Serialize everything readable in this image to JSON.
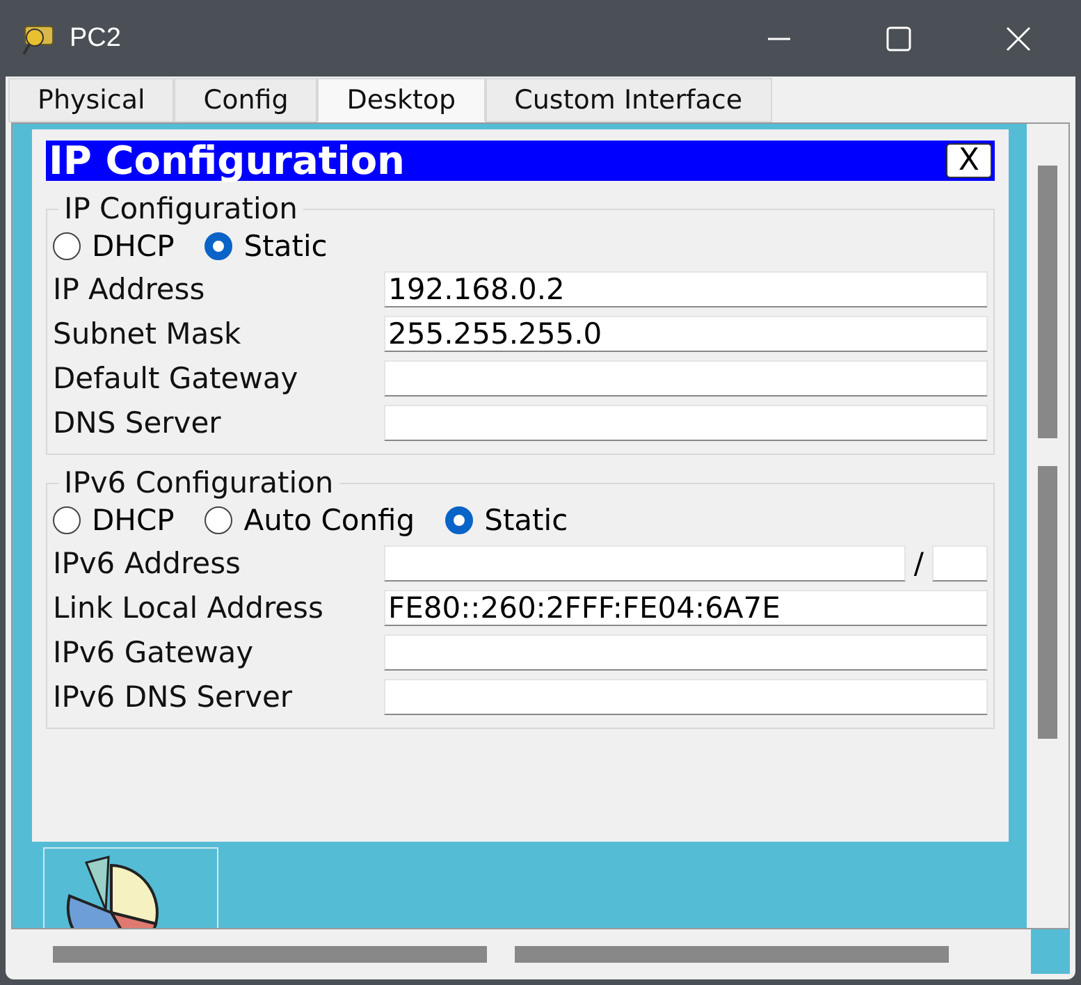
{
  "window": {
    "title": "PC2"
  },
  "tabs": [
    {
      "label": "Physical",
      "selected": false
    },
    {
      "label": "Config",
      "selected": false
    },
    {
      "label": "Desktop",
      "selected": true
    },
    {
      "label": "Custom Interface",
      "selected": false
    }
  ],
  "dialog": {
    "title": "IP Configuration",
    "close": "X",
    "ipv4": {
      "title": "IP Configuration",
      "modes": [
        {
          "label": "DHCP",
          "selected": false
        },
        {
          "label": "Static",
          "selected": true
        }
      ],
      "fields": [
        {
          "label": "IP Address",
          "value": "192.168.0.2"
        },
        {
          "label": "Subnet Mask",
          "value": "255.255.255.0"
        },
        {
          "label": "Default Gateway"
        },
        {
          "label": "DNS Server"
        }
      ]
    },
    "ipv6": {
      "title": "IPv6 Configuration",
      "modes": [
        {
          "label": "DHCP",
          "selected": false
        },
        {
          "label": "Auto Config",
          "selected": false
        },
        {
          "label": "Static",
          "selected": true
        }
      ],
      "fields": [
        {
          "label": "IPv6 Address",
          "prefix_separator": "/"
        },
        {
          "label": "Link Local Address",
          "value": "FE80::260:2FFF:FE04:6A7E"
        },
        {
          "label": "IPv6 Gateway"
        },
        {
          "label": "IPv6 DNS Server"
        }
      ]
    }
  }
}
